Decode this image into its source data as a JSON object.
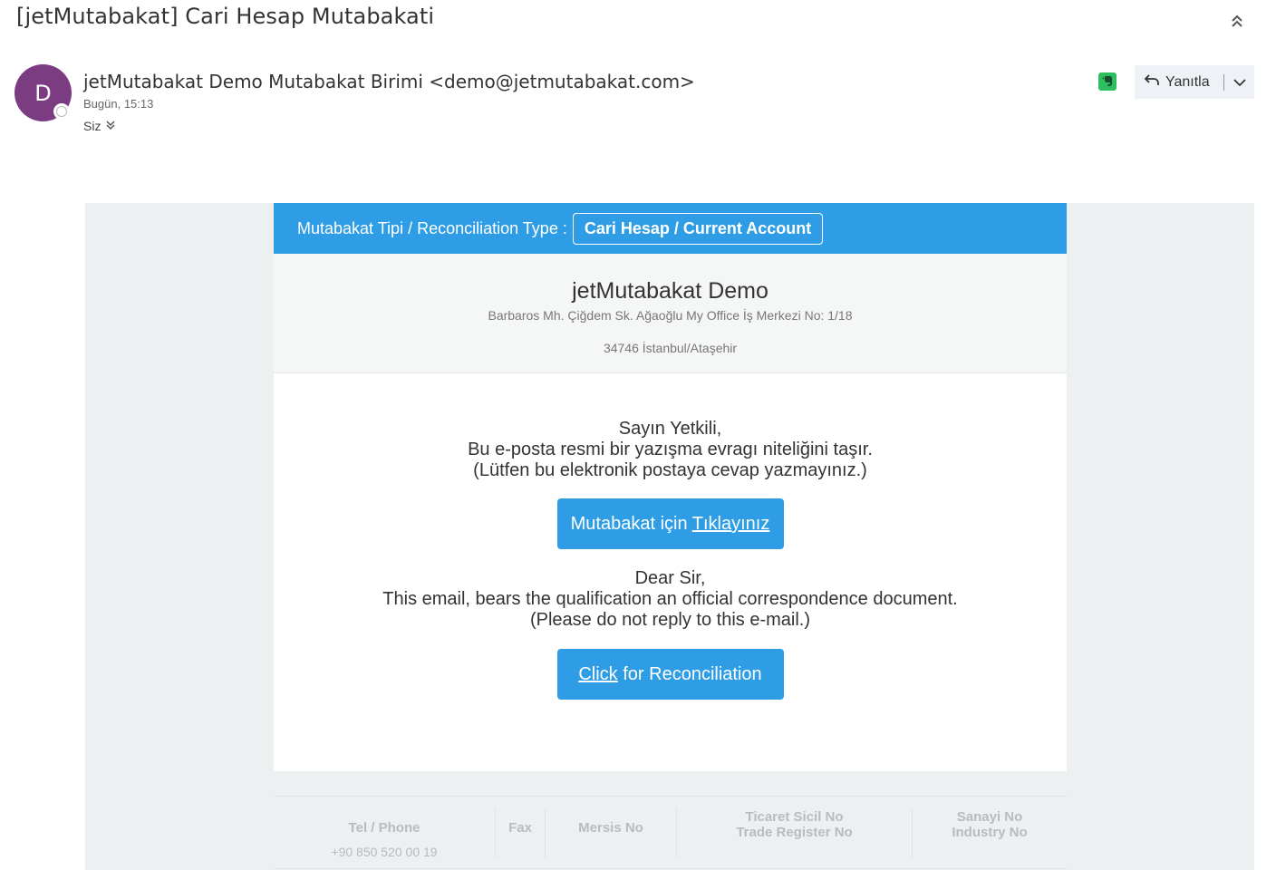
{
  "header": {
    "subject": "[jetMutabakat] Cari Hesap Mutabakati",
    "collapse_icon": "double-chevron-up-icon"
  },
  "sender": {
    "avatar_initial": "D",
    "avatar_color": "#7b3c82",
    "name": "jetMutabakat Demo Mutabakat Birimi <demo@jetmutabakat.com>",
    "date": "Bugün, 15:13",
    "to": "Siz",
    "to_expand_icon": "double-chevron-down-icon"
  },
  "actions": {
    "evernote_icon": "evernote-icon",
    "reply_label": "Yanıtla",
    "reply_icon": "reply-arrow-icon",
    "reply_dropdown_icon": "chevron-down-icon"
  },
  "email": {
    "accent_color": "#2f9de6",
    "type_label": "Mutabakat Tipi / Reconciliation Type :",
    "type_value": "Cari Hesap / Current Account",
    "company_name": "jetMutabakat Demo",
    "company_address": "Barbaros Mh. Çiğdem Sk. Ağaoğlu My Office İş Merkezi No: 1/18",
    "company_city": "34746 İstanbul/Ataşehir",
    "tr_greeting": "Sayın Yetkili,",
    "tr_line1": "Bu e-posta resmi bir yazışma evragı niteliğini taşır.",
    "tr_line2": "(Lütfen bu elektronik postaya cevap yazmayınız.)",
    "tr_button_text": "Mutabakat için ",
    "tr_button_link": "Tıklayınız",
    "en_greeting": "Dear Sir,",
    "en_line1": "This email, bears the qualification an official correspondence document.",
    "en_line2": "(Please do not reply to this e-mail.)",
    "en_button_link": "Click",
    "en_button_text": " for Reconciliation"
  },
  "footer": {
    "tel_label": "Tel / Phone",
    "tel_value": "+90 850 520 00 19",
    "fax_label": "Fax",
    "mersis_label": "Mersis No",
    "trade_label_1": "Ticaret Sicil No",
    "trade_label_2": "Trade Register No",
    "industry_label_1": "Sanayi No",
    "industry_label_2": "Industry No"
  }
}
